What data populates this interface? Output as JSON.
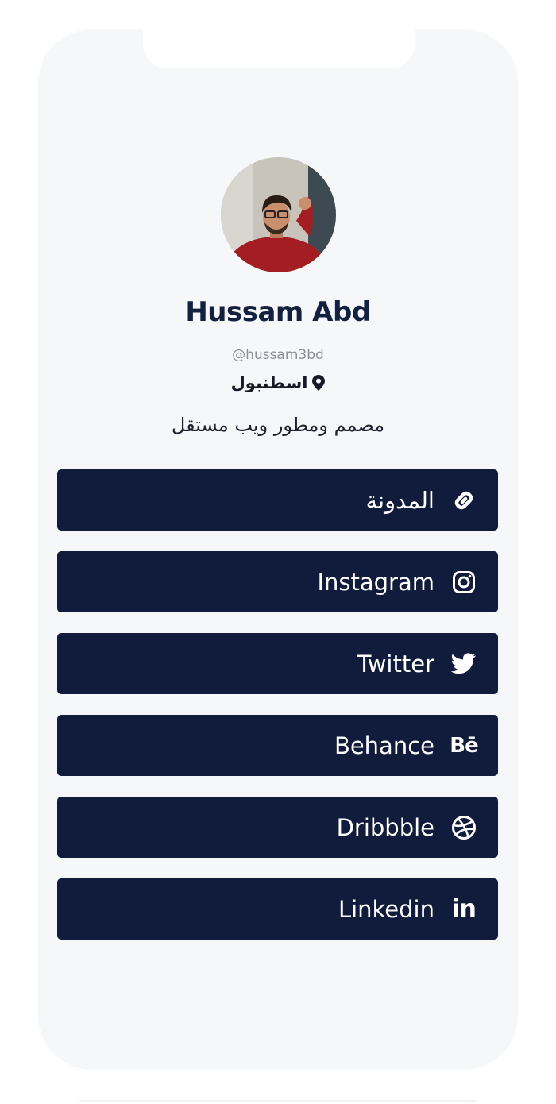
{
  "profile": {
    "name": "Hussam Abd",
    "handle": "@hussam3bd",
    "location": "اسطنبول",
    "bio": "مصمم ومطور ويب مستقل",
    "avatar_icon": "profile-photo"
  },
  "links": [
    {
      "label": "المدونة",
      "icon": "link-icon"
    },
    {
      "label": "Instagram",
      "icon": "instagram-icon"
    },
    {
      "label": "Twitter",
      "icon": "twitter-icon"
    },
    {
      "label": "Behance",
      "icon": "behance-icon",
      "icon_text": "Bē"
    },
    {
      "label": "Dribbble",
      "icon": "dribbble-icon"
    },
    {
      "label": "Linkedin",
      "icon": "linkedin-icon",
      "icon_text": "in"
    }
  ],
  "colors": {
    "button_bg": "#111c3c",
    "name_color": "#13203f",
    "page_bg": "#f6f7f9"
  }
}
